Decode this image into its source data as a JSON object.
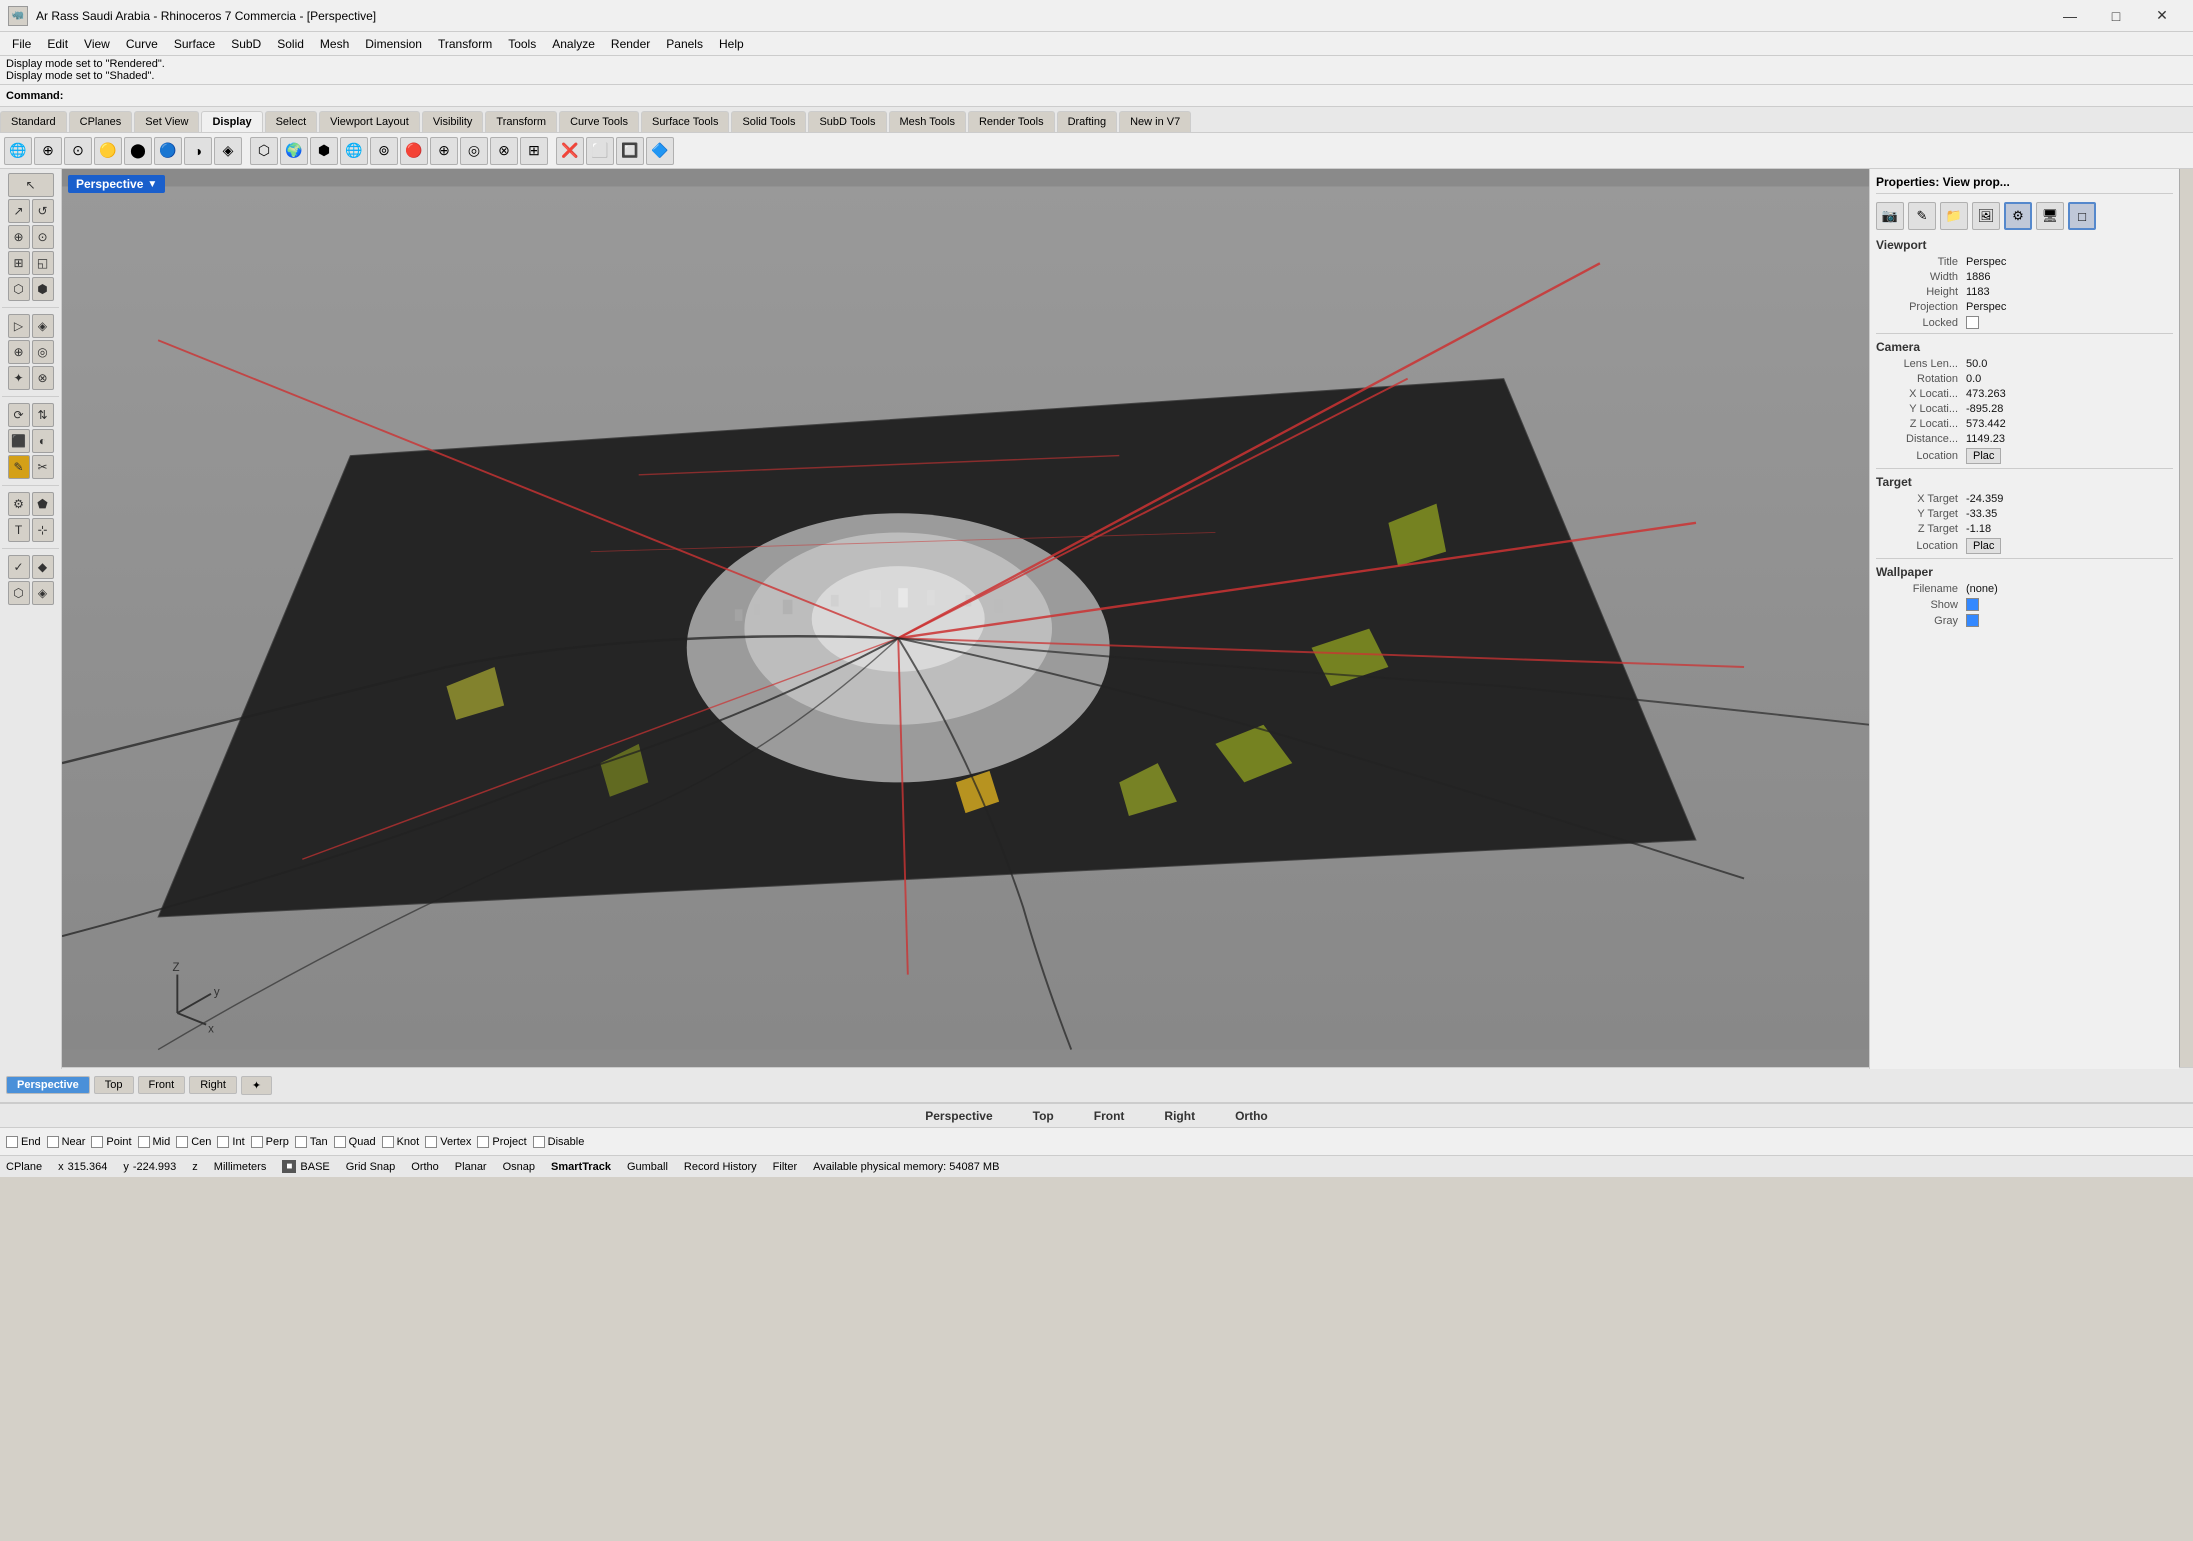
{
  "titlebar": {
    "title": "Ar Rass Saudi Arabia - Rhinoceros 7 Commercia - [Perspective]",
    "icon": "🦏",
    "controls": [
      "—",
      "□",
      "✕"
    ]
  },
  "menubar": {
    "items": [
      "File",
      "Edit",
      "View",
      "Curve",
      "Surface",
      "SubD",
      "Solid",
      "Mesh",
      "Dimension",
      "Transform",
      "Tools",
      "Analyze",
      "Render",
      "Panels",
      "Help"
    ]
  },
  "status": {
    "line1": "Display mode set to \"Rendered\".",
    "line2": "Display mode set to \"Shaded\".",
    "command_label": "Command:"
  },
  "toolbar_tabs": {
    "items": [
      "Standard",
      "CPlanes",
      "Set View",
      "Display",
      "Select",
      "Viewport Layout",
      "Visibility",
      "Transform",
      "Curve Tools",
      "Surface Tools",
      "Solid Tools",
      "SubD Tools",
      "Mesh Tools",
      "Render Tools",
      "Drafting",
      "New in V7"
    ]
  },
  "viewport": {
    "label": "Perspective",
    "arrow": "▼"
  },
  "right_panel": {
    "title": "Properties: View prop...",
    "sections": {
      "viewport": {
        "header": "Viewport",
        "props": [
          {
            "label": "Title",
            "value": "Perspec"
          },
          {
            "label": "Width",
            "value": "1886"
          },
          {
            "label": "Height",
            "value": "1183"
          },
          {
            "label": "Projection",
            "value": "Perspec"
          },
          {
            "label": "Locked",
            "value": "checkbox_unchecked"
          }
        ]
      },
      "camera": {
        "header": "Camera",
        "props": [
          {
            "label": "Lens Len...",
            "value": "50.0"
          },
          {
            "label": "Rotation",
            "value": "0.0"
          },
          {
            "label": "X Locati...",
            "value": "473.263"
          },
          {
            "label": "Y Locati...",
            "value": "-895.28"
          },
          {
            "label": "Z Locati...",
            "value": "573.442"
          },
          {
            "label": "Distance...",
            "value": "1149.23"
          },
          {
            "label": "Location",
            "value": "Plac",
            "is_button": true
          }
        ]
      },
      "target": {
        "header": "Target",
        "props": [
          {
            "label": "X Target",
            "value": "-24.359"
          },
          {
            "label": "Y Target",
            "value": "-33.35"
          },
          {
            "label": "Z Target",
            "value": "-1.18"
          },
          {
            "label": "Location",
            "value": "Plac",
            "is_button": true
          }
        ]
      },
      "wallpaper": {
        "header": "Wallpaper",
        "props": [
          {
            "label": "Filename",
            "value": "(none)"
          },
          {
            "label": "Show",
            "value": "checkbox_checked"
          },
          {
            "label": "Gray",
            "value": "checkbox_checked"
          }
        ]
      }
    }
  },
  "viewport_tabs": {
    "items": [
      "Perspective",
      "Top",
      "Front",
      "Right"
    ],
    "active": "Perspective",
    "extra": "✦"
  },
  "snap_bar": {
    "items": [
      {
        "label": "End",
        "checked": false
      },
      {
        "label": "Near",
        "checked": false
      },
      {
        "label": "Point",
        "checked": false
      },
      {
        "label": "Mid",
        "checked": false
      },
      {
        "label": "Cen",
        "checked": false
      },
      {
        "label": "Int",
        "checked": false
      },
      {
        "label": "Perp",
        "checked": false
      },
      {
        "label": "Tan",
        "checked": false
      },
      {
        "label": "Quad",
        "checked": false
      },
      {
        "label": "Knot",
        "checked": false
      },
      {
        "label": "Vertex",
        "checked": false
      },
      {
        "label": "Project",
        "checked": false
      },
      {
        "label": "Disable",
        "checked": false
      }
    ]
  },
  "status_bar": {
    "cplane": "CPlane",
    "x_label": "x",
    "x_value": "315.364",
    "y_label": "y",
    "y_value": "-224.993",
    "z_label": "z",
    "unit": "Millimeters",
    "layer": "BASE",
    "grid_snap": "Grid Snap",
    "ortho": "Ortho",
    "planar": "Planar",
    "osnap": "Osnap",
    "smarttrack": "SmartTrack",
    "gumball": "Gumball",
    "record_history": "Record History",
    "filter": "Filter",
    "memory": "Available physical memory: 54087 MB"
  },
  "sidebar_icons": [
    "↖",
    "↗",
    "↺",
    "⊞",
    "⊙",
    "⊘",
    "◱",
    "⬡",
    "⬢",
    "▷",
    "⊡",
    "◈",
    "⊕",
    "◎",
    "✦",
    "⊗",
    "⟳",
    "⇅",
    "⬛",
    "◐",
    "✎",
    "✂",
    "⚙",
    "⬟",
    "T",
    "⊹",
    "✓",
    "◆"
  ],
  "toolbar_icons": [
    "🔵",
    "⊕",
    "⊙",
    "◎",
    "⊚",
    "⊛",
    "⊜",
    "⊝",
    "⊞",
    "⊟",
    "⊠",
    "⊡",
    "◈",
    "◉",
    "◊",
    "⬡",
    "⬢",
    "⬣",
    "⬤",
    "⬥",
    "⬦"
  ],
  "colors": {
    "accent_blue": "#1a5fcc",
    "viewport_bg": "#8a8a8a",
    "road_red": "#cc3333",
    "panel_bg": "#f0f0f0",
    "active_tab": "#4a90d9"
  }
}
